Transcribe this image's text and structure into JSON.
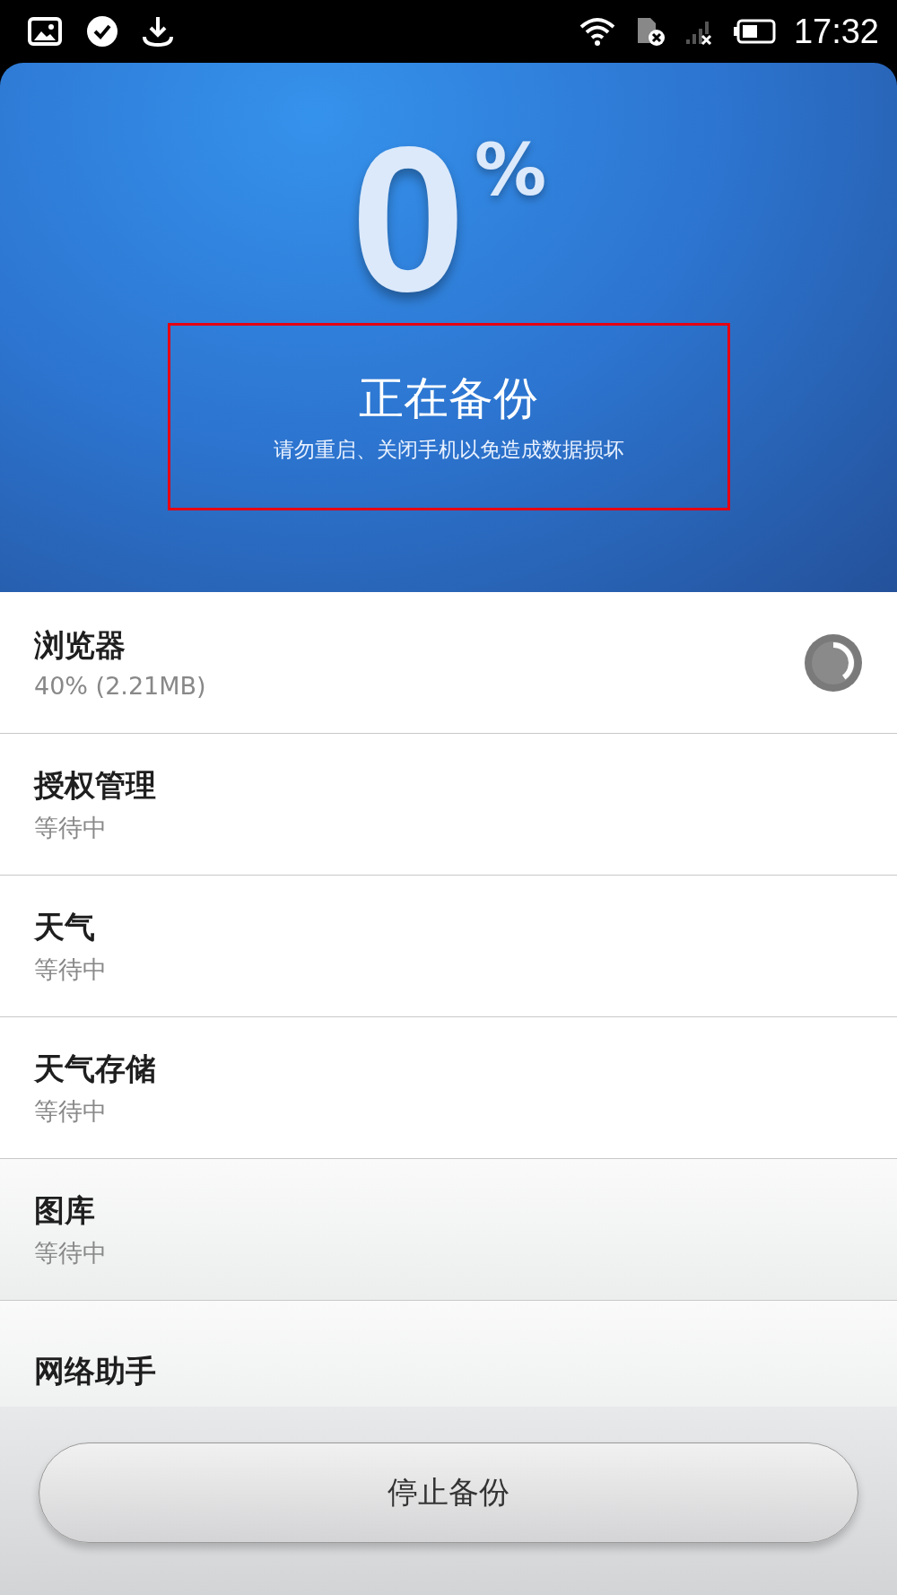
{
  "status_bar": {
    "time": "17:32"
  },
  "progress": {
    "value": "0",
    "unit": "%",
    "title": "正在备份",
    "subtitle": "请勿重启、关闭手机以免造成数据损坏",
    "highlighted": true
  },
  "items": [
    {
      "name": "浏览器",
      "status": "40% (2.21MB)",
      "kind": "active",
      "level": 0.4
    },
    {
      "name": "授权管理",
      "status": "等待中",
      "kind": "waiting"
    },
    {
      "name": "天气",
      "status": "等待中",
      "kind": "waiting"
    },
    {
      "name": "天气存储",
      "status": "等待中",
      "kind": "waiting"
    },
    {
      "name": "图库",
      "status": "等待中",
      "kind": "waiting"
    },
    {
      "name": "网络助手",
      "kind": "waiting"
    }
  ],
  "stop_button": {
    "label": "停止备份"
  }
}
